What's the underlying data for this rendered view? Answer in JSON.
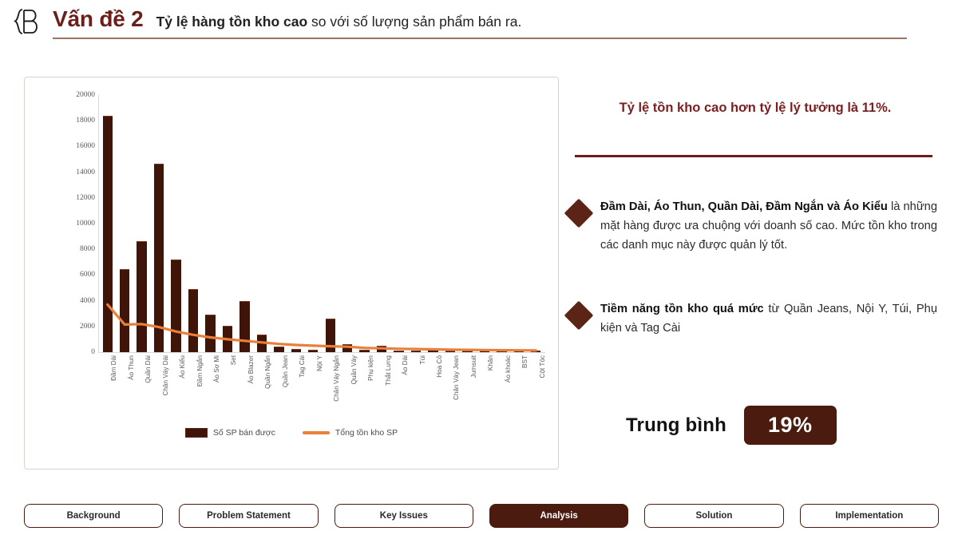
{
  "header": {
    "logo_icon": "bb-monogram-logo",
    "title_main": "Vấn đề 2",
    "subtitle_bold": "Tỷ lệ hàng tồn kho cao",
    "subtitle_rest": " so với số lượng sản phẩm bán ra."
  },
  "right_panel": {
    "kicker": "Tỷ lệ tồn kho  cao hơn tỷ lệ lý tưởng là 11%.",
    "bullets": [
      {
        "bold": "Đầm Dài, Áo Thun, Quần Dài, Đầm Ngắn và Áo Kiểu",
        "rest": " là những mặt hàng được ưa chuộng với doanh số cao. Mức tồn kho trong các danh mục này được quản lý tốt."
      },
      {
        "bold": "Tiềm năng tồn kho quá mức",
        "rest": " từ Quần Jeans, Nội Y, Túi, Phụ kiện và Tag Cài"
      }
    ],
    "average_label": "Trung bình",
    "average_value": "19%"
  },
  "nav": {
    "items": [
      {
        "label": "Background",
        "active": false
      },
      {
        "label": "Problem Statement",
        "active": false
      },
      {
        "label": "Key Issues",
        "active": false
      },
      {
        "label": "Analysis",
        "active": true
      },
      {
        "label": "Solution",
        "active": false
      },
      {
        "label": "Implementation",
        "active": false
      }
    ]
  },
  "colors": {
    "brand_maroon": "#6B1F1A",
    "bar_dark": "#3F1409",
    "line_orange": "#E8803A",
    "accent_red": "#7B1F20"
  },
  "chart_data": {
    "type": "bar",
    "title": "",
    "xlabel": "",
    "ylabel": "",
    "ylim": [
      0,
      20000
    ],
    "yticks": [
      0,
      2000,
      4000,
      6000,
      8000,
      10000,
      12000,
      14000,
      16000,
      18000,
      20000
    ],
    "grid": false,
    "legend_position": "bottom",
    "categories": [
      "Đầm Dài",
      "Áo Thun",
      "Quần Dài",
      "Chân Váy Dài",
      "Áo Kiểu",
      "Đầm Ngắn",
      "Áo Sơ Mi",
      "Set",
      "Áo Blazer",
      "Quần Ngắn",
      "Quần Jean",
      "Tag Cài",
      "Nội Y",
      "Chân Váy Ngắn",
      "Quần Váy",
      "Phụ kiện",
      "Thắt Lưng",
      "Áo Dài",
      "Túi",
      "Hoa Cỏ",
      "Chân Váy Jean",
      "Jumsuit",
      "Khăn",
      "Áo khoác",
      "BST",
      "Cột Tóc"
    ],
    "series": [
      {
        "name": "Số SP bán được",
        "type": "bar",
        "color": "#3F1409",
        "values": [
          18300,
          6400,
          8550,
          14600,
          7150,
          4850,
          2850,
          1980,
          3900,
          1300,
          380,
          200,
          150,
          2550,
          560,
          120,
          420,
          90,
          70,
          230,
          40,
          30,
          25,
          20,
          15,
          10
        ]
      },
      {
        "name": "Tổng tồn kho SP",
        "type": "line",
        "color": "#E8803A",
        "values": [
          3700,
          2150,
          2180,
          1950,
          1600,
          1350,
          1150,
          1000,
          880,
          760,
          640,
          560,
          500,
          460,
          420,
          330,
          300,
          260,
          240,
          215,
          195,
          180,
          165,
          150,
          140,
          130
        ]
      }
    ]
  }
}
